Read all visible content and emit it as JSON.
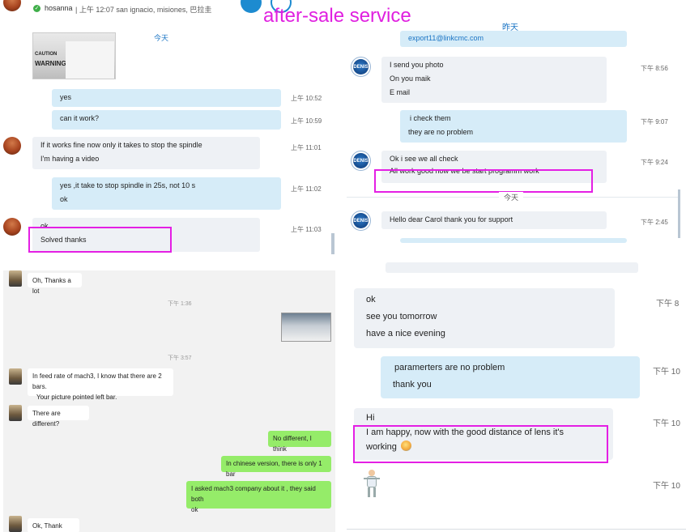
{
  "overlay_title": "after-sale service",
  "header": {
    "contact_name": "hosanna",
    "status_line": "| 上午 12:07 san ignacio, misiones, 巴拉圭"
  },
  "top_left": {
    "day_divider": "今天",
    "photo_caption_1": "CAUTION",
    "photo_caption_2": "WARNING",
    "messages": [
      {
        "text": "yes",
        "time": "上午 10:52"
      },
      {
        "text": "can it work?",
        "time": "上午 10:59"
      },
      {
        "lines": [
          "If it works fine now only it takes to stop the spindle",
          "I'm having a video"
        ],
        "time": "上午 11:01"
      },
      {
        "lines": [
          "yes ,it take to stop spindle in 25s, not 10 s",
          "ok"
        ],
        "time": "上午 11:02"
      },
      {
        "lines": [
          "ok",
          "Solved thanks"
        ],
        "time": "上午 11:03"
      }
    ]
  },
  "bottom_left": {
    "messages": [
      {
        "text": "Oh, Thanks a lot"
      },
      {
        "time": "下午 1:36"
      },
      {
        "time": "下午 3:57"
      },
      {
        "lines": [
          "In feed rate of mach3, I know that there are 2 bars.",
          "Your picture pointed left bar."
        ]
      },
      {
        "text": "There are different?"
      },
      {
        "text": "No different, I think"
      },
      {
        "text": "In chinese version, there is only 1 bar"
      },
      {
        "lines": [
          "I asked mach3 company about it , they said both",
          "ok"
        ]
      },
      {
        "text": "Ok, Thank you."
      }
    ]
  },
  "top_right": {
    "day_divider_1": "昨天",
    "day_divider_2": "今天",
    "email_fragment": "export11@linkcmc.com",
    "avatar_label": "DENIS",
    "messages": [
      {
        "lines": [
          "I send you photo",
          "On you maik",
          "E mail"
        ],
        "time": "下午 8:56"
      },
      {
        "lines": [
          "i  check  them",
          "they are no problem"
        ],
        "time": "下午 9:07"
      },
      {
        "lines": [
          "Ok i see we all check",
          "All work good now we be start programm work"
        ],
        "time": "下午 9:24"
      },
      {
        "text": "Hello dear Carol thank you for support",
        "time": "下午 2:45"
      }
    ]
  },
  "bottom_right": {
    "messages": [
      {
        "lines": [
          "ok",
          "see you tomorrow",
          "have a nice evening"
        ],
        "time": "下午 8"
      },
      {
        "lines": [
          "paramerters are no problem",
          "thank you"
        ],
        "time": "下午 10"
      },
      {
        "lines": [
          "Hi",
          "I am happy, now with the good distance of lens it's",
          "working"
        ],
        "time": "下午 10"
      },
      {
        "time": "下午 10"
      }
    ]
  },
  "colors": {
    "highlight": "#e41fe4",
    "incoming": "#eef1f5",
    "outgoing": "#d6ecf8",
    "wechat_out": "#95ec69"
  }
}
